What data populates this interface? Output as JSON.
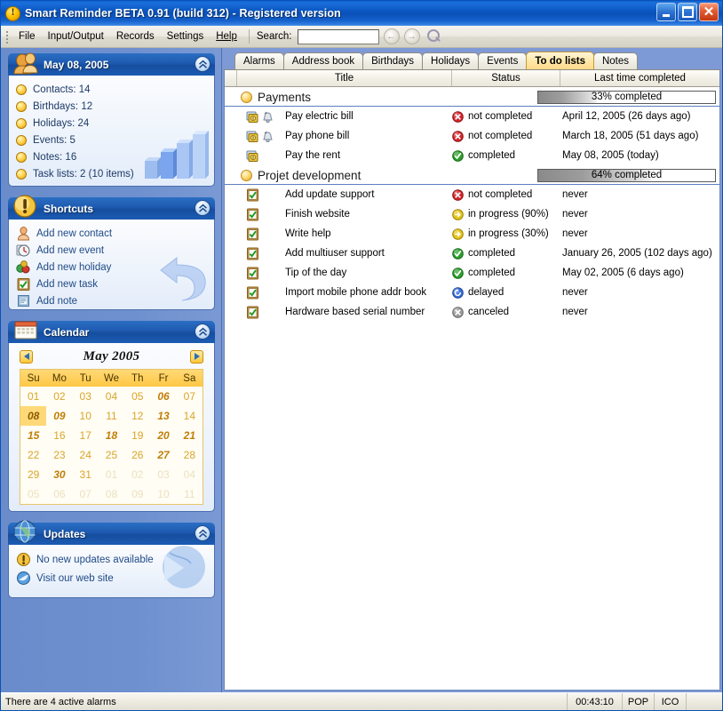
{
  "window": {
    "title": "Smart Reminder BETA 0.91 (build 312) - Registered version",
    "app_icon": "exclamation-icon",
    "minimize": "_",
    "maximize": "□",
    "close": "✕"
  },
  "menu": {
    "items": [
      {
        "label": "File"
      },
      {
        "label": "Input/Output"
      },
      {
        "label": "Records"
      },
      {
        "label": "Settings"
      },
      {
        "label": "Help"
      }
    ],
    "search_label": "Search:",
    "search_value": "",
    "search_placeholder": "",
    "nav_back": "back-icon",
    "nav_forward": "forward-icon",
    "find": "magnifier-icon"
  },
  "sidebar": {
    "stats_panel": {
      "title": "May 08, 2005",
      "icon": "contacts-icon",
      "collapse": "collapse-icon",
      "items": [
        {
          "label": "Contacts: 14"
        },
        {
          "label": "Birthdays: 12"
        },
        {
          "label": "Holidays: 24"
        },
        {
          "label": "Events: 5"
        },
        {
          "label": "Notes: 16"
        },
        {
          "label": "Task lists: 2 (10 items)"
        }
      ]
    },
    "shortcuts_panel": {
      "title": "Shortcuts",
      "icon": "warning-icon",
      "collapse": "collapse-icon",
      "items": [
        {
          "label": "Add new contact",
          "icon": "person-icon"
        },
        {
          "label": "Add new event",
          "icon": "clock-icon"
        },
        {
          "label": "Add new holiday",
          "icon": "gift-icon"
        },
        {
          "label": "Add new task",
          "icon": "checklist-icon"
        },
        {
          "label": "Add note",
          "icon": "note-icon"
        }
      ]
    },
    "calendar_panel": {
      "title": "Calendar",
      "icon": "calendar-icon",
      "collapse": "collapse-icon",
      "month_label": "May 2005",
      "prev": "prev-month-icon",
      "next": "next-month-icon",
      "weekdays": [
        "Su",
        "Mo",
        "Tu",
        "We",
        "Th",
        "Fr",
        "Sa"
      ],
      "weeks": [
        [
          {
            "d": "01",
            "s": "normal"
          },
          {
            "d": "02",
            "s": "normal"
          },
          {
            "d": "03",
            "s": "normal"
          },
          {
            "d": "04",
            "s": "normal"
          },
          {
            "d": "05",
            "s": "normal"
          },
          {
            "d": "06",
            "s": "bold"
          },
          {
            "d": "07",
            "s": "normal"
          }
        ],
        [
          {
            "d": "08",
            "s": "today"
          },
          {
            "d": "09",
            "s": "bold"
          },
          {
            "d": "10",
            "s": "normal"
          },
          {
            "d": "11",
            "s": "normal"
          },
          {
            "d": "12",
            "s": "normal"
          },
          {
            "d": "13",
            "s": "bold"
          },
          {
            "d": "14",
            "s": "normal"
          }
        ],
        [
          {
            "d": "15",
            "s": "bold"
          },
          {
            "d": "16",
            "s": "normal"
          },
          {
            "d": "17",
            "s": "normal"
          },
          {
            "d": "18",
            "s": "bold"
          },
          {
            "d": "19",
            "s": "normal"
          },
          {
            "d": "20",
            "s": "bold"
          },
          {
            "d": "21",
            "s": "bold"
          }
        ],
        [
          {
            "d": "22",
            "s": "normal"
          },
          {
            "d": "23",
            "s": "normal"
          },
          {
            "d": "24",
            "s": "normal"
          },
          {
            "d": "25",
            "s": "normal"
          },
          {
            "d": "26",
            "s": "normal"
          },
          {
            "d": "27",
            "s": "bold"
          },
          {
            "d": "28",
            "s": "normal"
          }
        ],
        [
          {
            "d": "29",
            "s": "normal"
          },
          {
            "d": "30",
            "s": "bold"
          },
          {
            "d": "31",
            "s": "normal"
          },
          {
            "d": "01",
            "s": "out"
          },
          {
            "d": "02",
            "s": "out"
          },
          {
            "d": "03",
            "s": "out"
          },
          {
            "d": "04",
            "s": "out"
          }
        ],
        [
          {
            "d": "05",
            "s": "out"
          },
          {
            "d": "06",
            "s": "out"
          },
          {
            "d": "07",
            "s": "out"
          },
          {
            "d": "08",
            "s": "out"
          },
          {
            "d": "09",
            "s": "out"
          },
          {
            "d": "10",
            "s": "out"
          },
          {
            "d": "11",
            "s": "out"
          }
        ]
      ]
    },
    "updates_panel": {
      "title": "Updates",
      "icon": "globe-icon",
      "collapse": "collapse-icon",
      "items": [
        {
          "label": "No new updates available",
          "icon": "warning-icon"
        },
        {
          "label": "Visit our web site",
          "icon": "browser-icon"
        }
      ]
    }
  },
  "main": {
    "tabs": [
      {
        "label": "Alarms",
        "active": false
      },
      {
        "label": "Address book",
        "active": false
      },
      {
        "label": "Birthdays",
        "active": false
      },
      {
        "label": "Holidays",
        "active": false
      },
      {
        "label": "Events",
        "active": false
      },
      {
        "label": "To do lists",
        "active": true
      },
      {
        "label": "Notes",
        "active": false
      }
    ],
    "columns": [
      "Title",
      "Status",
      "Last time completed"
    ],
    "groups": [
      {
        "title": "Payments",
        "progress_label": "33% completed",
        "progress_pct": 33,
        "tasks": [
          {
            "title": "Pay electric bill",
            "icons": [
              "money-icon",
              "bell-icon"
            ],
            "status": "not completed",
            "status_icon": "error-icon",
            "last": "April 12, 2005 (26 days ago)"
          },
          {
            "title": "Pay phone bill",
            "icons": [
              "money-icon",
              "bell-icon"
            ],
            "status": "not completed",
            "status_icon": "error-icon",
            "last": "March 18, 2005 (51 days ago)"
          },
          {
            "title": "Pay the rent",
            "icons": [
              "money-icon"
            ],
            "status": "completed",
            "status_icon": "success-icon",
            "last": "May 08, 2005 (today)"
          }
        ]
      },
      {
        "title": "Projet development",
        "progress_label": "64% completed",
        "progress_pct": 64,
        "tasks": [
          {
            "title": "Add update support",
            "icons": [
              "checklist-icon"
            ],
            "status": "not completed",
            "status_icon": "error-icon",
            "last": "never"
          },
          {
            "title": "Finish website",
            "icons": [
              "checklist-icon"
            ],
            "status": "in progress (90%)",
            "status_icon": "progress-icon",
            "last": "never"
          },
          {
            "title": "Write help",
            "icons": [
              "checklist-icon"
            ],
            "status": "in progress (30%)",
            "status_icon": "progress-icon",
            "last": "never"
          },
          {
            "title": "Add multiuser support",
            "icons": [
              "checklist-icon"
            ],
            "status": "completed",
            "status_icon": "success-icon",
            "last": "January 26, 2005 (102 days ago)"
          },
          {
            "title": "Tip of the day",
            "icons": [
              "checklist-icon"
            ],
            "status": "completed",
            "status_icon": "success-icon",
            "last": "May 02, 2005 (6 days ago)"
          },
          {
            "title": "Import mobile phone addr book",
            "icons": [
              "checklist-icon"
            ],
            "status": "delayed",
            "status_icon": "delayed-icon",
            "last": "never"
          },
          {
            "title": "Hardware based serial number",
            "icons": [
              "checklist-icon"
            ],
            "status": "canceled",
            "status_icon": "canceled-icon",
            "last": "never"
          }
        ]
      }
    ]
  },
  "statusbar": {
    "message": "There are 4 active alarms",
    "time": "00:43:10",
    "pop": "POP",
    "ico": "ICO",
    "end": ""
  },
  "colors": {
    "titlebar_blue": "#0a51b8",
    "desktop_blue": "#6b8ccd",
    "panel_header": "#1d5ab0",
    "accent_gold": "#ffc845",
    "tab_active": "#ffe6a5",
    "status_error": "#d5262c",
    "status_success": "#2da02d",
    "status_progress": "#e6c417",
    "status_delayed": "#3a6fd8",
    "status_canceled": "#9a9a9a"
  }
}
